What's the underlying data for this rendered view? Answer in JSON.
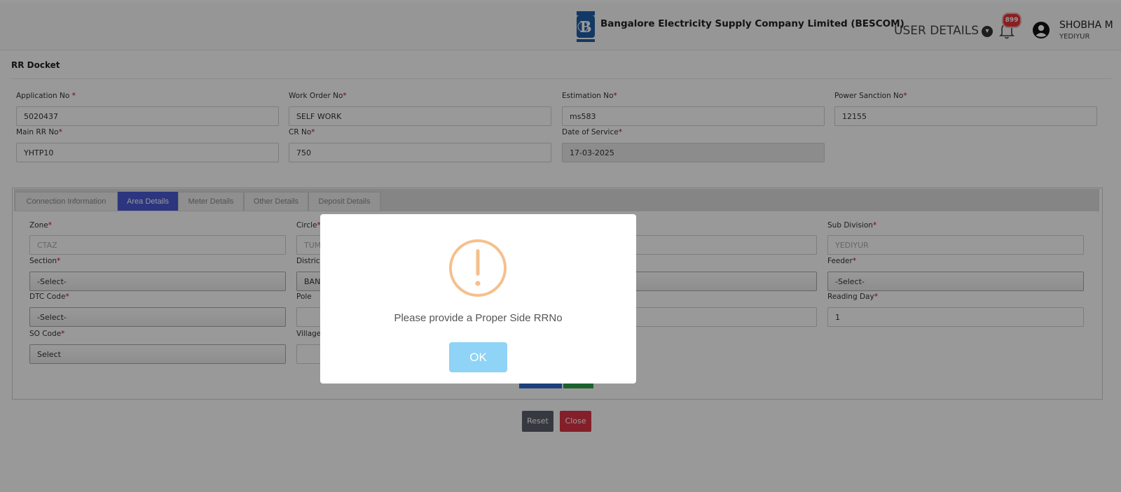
{
  "header": {
    "company_name": "Bangalore Electricity Supply Company Limited (BESCOM)",
    "logo_text": "BESCOM",
    "user_details_label": "USER DETAILS",
    "notification_count": "899",
    "user_name": "SHOBHA M",
    "user_location": "YEDIYUR"
  },
  "page": {
    "title": "RR Docket"
  },
  "docket_fields": [
    {
      "label": "Application No ",
      "required": "*",
      "value": "5020437"
    },
    {
      "label": "Work Order No",
      "required": "*",
      "value": "SELF WORK"
    },
    {
      "label": "Estimation No",
      "required": "*",
      "value": "ms583"
    },
    {
      "label": "Power Sanction No",
      "required": "*",
      "value": "12155"
    },
    {
      "label": "Main RR No",
      "required": "*",
      "value": "YHTP10"
    },
    {
      "label": "CR No",
      "required": "*",
      "value": "750"
    },
    {
      "label": "Date of Service",
      "required": "*",
      "value": "17-03-2025"
    }
  ],
  "tabs": [
    {
      "label": "Connection Information"
    },
    {
      "label": "Area Details"
    },
    {
      "label": "Meter Details"
    },
    {
      "label": "Other Details"
    },
    {
      "label": "Deposit Details"
    }
  ],
  "area_fields": {
    "zone": {
      "label": "Zone",
      "required": "*",
      "value": "CTAZ"
    },
    "circle": {
      "label": "Circle",
      "required": "*",
      "value": "TUMK"
    },
    "sub_division": {
      "label": "Sub Division",
      "required": "*",
      "value": "YEDIYUR"
    },
    "section": {
      "label": "Section",
      "required": "*",
      "value": "-Select-"
    },
    "district": {
      "label": "District",
      "value": "BANG"
    },
    "feeder": {
      "label": "Feeder",
      "required": "*",
      "value": "-Select-"
    },
    "dtc_code": {
      "label": "DTC Code",
      "required": "*",
      "value": "-Select-"
    },
    "pole": {
      "label": "Pole",
      "value": ""
    },
    "reading_day": {
      "label": "Reading Day",
      "required": "*",
      "value": "1"
    },
    "so_code": {
      "label": "SO Code",
      "required": "*",
      "value": "Select"
    },
    "village": {
      "label": "Village",
      "value": ""
    }
  },
  "buttons": {
    "reset": "Reset",
    "close": "Close"
  },
  "modal": {
    "message": "Please provide a Proper Side RRNo",
    "ok": "OK"
  },
  "colors": {
    "active_tab": "#4a59d3",
    "reset_button": "#5a5f6b",
    "close_button": "#dc3545",
    "ok_button": "#8fd3f6",
    "warning_icon": "#f5c08c",
    "required_marker": "#d0021b",
    "notification_badge": "#e5343a"
  },
  "icons": [
    "bescom-logo-icon",
    "chevron-down-icon",
    "bell-icon",
    "user-avatar-icon",
    "warning-icon"
  ]
}
